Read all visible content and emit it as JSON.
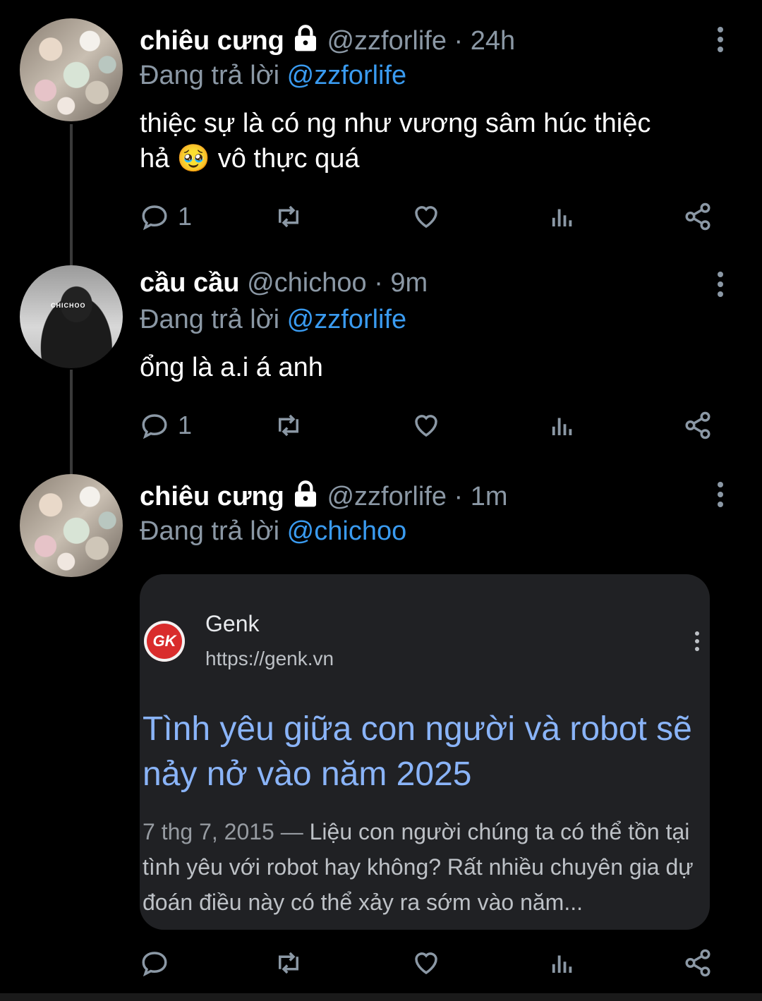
{
  "tweets": [
    {
      "name": "chiêu cưng",
      "handle": "@zzforlife · 24h",
      "reply_prefix": "Đang trả lời",
      "reply_to": "@zzforlife",
      "text_line1": "thiệc sự là có ng như vương sâm húc thiệc",
      "text_line2": "hả 🥹 vô thực quá",
      "reply_count": "1",
      "locked": true
    },
    {
      "name": "cầu cầu",
      "handle": "@chichoo · 9m",
      "reply_prefix": "Đang trả lời",
      "reply_to": "@zzforlife",
      "text_line1": "ổng là a.i á anh",
      "reply_count": "1",
      "locked": false,
      "avatar_text": "CHICHOO"
    },
    {
      "name": "chiêu cưng",
      "handle": "@zzforlife · 1m",
      "reply_prefix": "Đang trả lời",
      "reply_to": "@chichoo",
      "locked": true
    }
  ],
  "link_card": {
    "site_name": "Genk",
    "site_url": "https://genk.vn",
    "logo_text": "GK",
    "title": "Tình yêu giữa con người và robot sẽ nảy nở vào năm 2025",
    "date": "7 thg 7, 2015 —",
    "description": "Liệu con người chúng ta có thể tồn tại tình yêu với robot hay không? Rất nhiều chuyên gia dự đoán điều này có thể xảy ra sớm vào năm..."
  },
  "icons": [
    "reply-icon",
    "retweet-icon",
    "like-icon",
    "analytics-icon",
    "share-icon",
    "more-icon",
    "lock-icon"
  ],
  "colors": {
    "background": "#000000",
    "mention": "#3a9bf0",
    "muted": "#8b98a5",
    "card_title": "#8ab4f8"
  }
}
